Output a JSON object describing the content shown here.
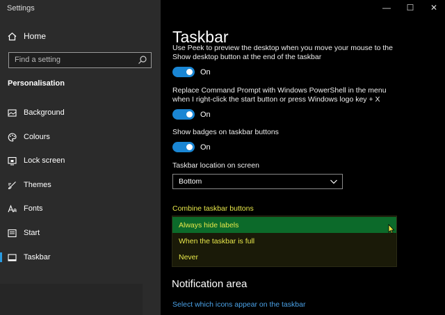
{
  "app": {
    "title": "Settings"
  },
  "sidebar": {
    "home_label": "Home",
    "search_placeholder": "Find a setting",
    "section_title": "Personalisation",
    "items": [
      {
        "label": "Background",
        "icon": "image-icon"
      },
      {
        "label": "Colours",
        "icon": "palette-icon"
      },
      {
        "label": "Lock screen",
        "icon": "lock-screen-icon"
      },
      {
        "label": "Themes",
        "icon": "themes-brush-icon"
      },
      {
        "label": "Fonts",
        "icon": "fonts-icon"
      },
      {
        "label": "Start",
        "icon": "start-icon"
      },
      {
        "label": "Taskbar",
        "icon": "taskbar-icon",
        "active": true
      }
    ]
  },
  "window_controls": {
    "minimize": "—",
    "maximize": "☐",
    "close": "✕"
  },
  "main": {
    "title": "Taskbar",
    "peek_text": "Use Peek to preview the desktop when you move your mouse to the Show desktop button at the end of the taskbar",
    "peek_toggle": "On",
    "powershell_text": "Replace Command Prompt with Windows PowerShell in the menu when I right-click the start button or press Windows logo key + X",
    "powershell_toggle": "On",
    "badges_text": "Show badges on taskbar buttons",
    "badges_toggle": "On",
    "location_label": "Taskbar location on screen",
    "location_value": "Bottom",
    "combine_label": "Combine taskbar buttons",
    "combine_options": [
      "Always hide labels",
      "When the taskbar is full",
      "Never"
    ],
    "combine_selected": "Always hide labels",
    "notification_heading": "Notification area",
    "notification_link": "Select which icons appear on the taskbar"
  },
  "colors": {
    "accent": "#1a86d4",
    "highlight_text": "#e8e84a",
    "selected_bg": "#0c6a2a",
    "link": "#4aa2e8"
  }
}
